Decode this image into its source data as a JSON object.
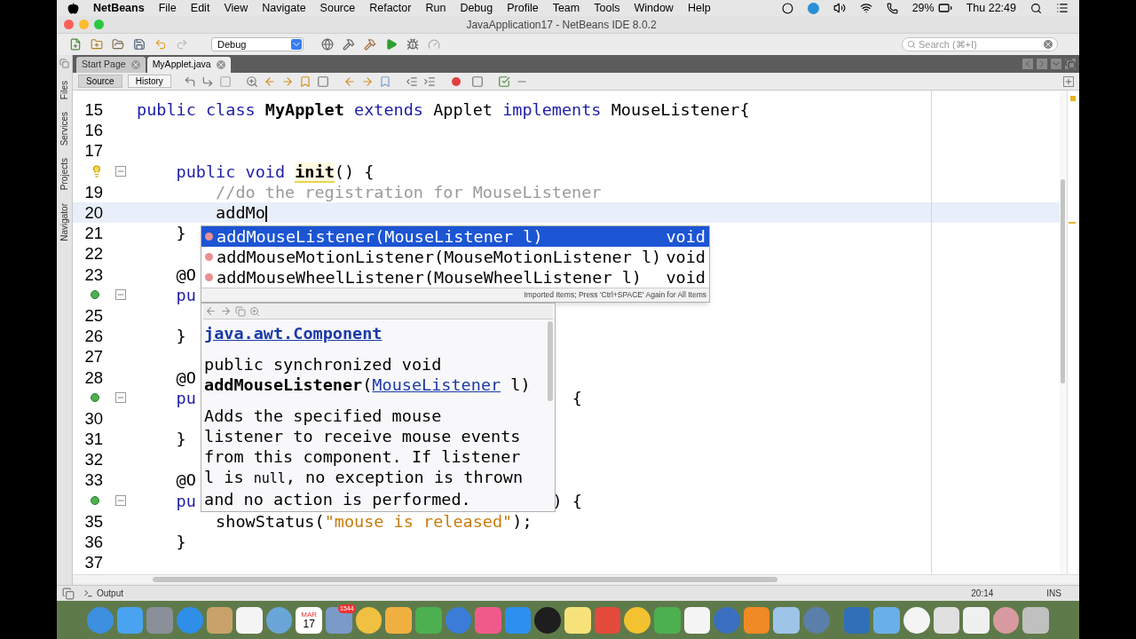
{
  "menu_bar": {
    "app": "NetBeans",
    "items": [
      "File",
      "Edit",
      "View",
      "Navigate",
      "Source",
      "Refactor",
      "Run",
      "Debug",
      "Profile",
      "Team",
      "Tools",
      "Window",
      "Help"
    ],
    "battery": "29%",
    "clock": "Thu 22:49"
  },
  "window": {
    "title": "JavaApplication17 - NetBeans IDE 8.0.2"
  },
  "toolbar": {
    "configuration": "Debug",
    "search": {
      "placeholder": "Search (⌘+I)"
    }
  },
  "side_tabs": [
    "Files",
    "Services",
    "Projects",
    "Navigator"
  ],
  "editor_tabs": [
    {
      "label": "Start Page",
      "selected": false
    },
    {
      "label": "MyApplet.java",
      "selected": true
    }
  ],
  "view_tabs": [
    {
      "label": "Source",
      "selected": true
    },
    {
      "label": "History",
      "selected": false
    }
  ],
  "code_lines": [
    {
      "number": "15",
      "tokens": [
        {
          "kind": "keyword",
          "text": "public class "
        },
        {
          "kind": "bold",
          "text": "MyApplet"
        },
        {
          "kind": "keyword",
          "text": " extends "
        },
        {
          "kind": "plain",
          "text": "Applet "
        },
        {
          "kind": "keyword",
          "text": "implements "
        },
        {
          "kind": "plain",
          "text": "MouseListener{"
        }
      ]
    },
    {
      "number": "16"
    },
    {
      "number": "17"
    },
    {
      "kind": "hint",
      "foldable": true,
      "tokens": [
        {
          "kind": "keyword",
          "text": "    public void "
        },
        {
          "kind": "highlighted",
          "text": "init"
        },
        {
          "kind": "plain",
          "text": "() {"
        }
      ]
    },
    {
      "number": "19",
      "tokens": [
        {
          "kind": "comment",
          "text": "        //do the registration for MouseListener"
        }
      ]
    },
    {
      "number": "20",
      "current": true,
      "cursor": true,
      "tokens": [
        {
          "kind": "plain",
          "text": "        addMo"
        }
      ]
    },
    {
      "number": "21",
      "tokens": [
        {
          "kind": "plain",
          "text": "    }"
        }
      ]
    },
    {
      "number": "22"
    },
    {
      "number": "23",
      "tokens": [
        {
          "kind": "plain",
          "text": "    @O"
        }
      ]
    },
    {
      "kind": "override",
      "foldable": true,
      "tokens": [
        {
          "kind": "keyword",
          "text": "    pu"
        }
      ]
    },
    {
      "number": "25"
    },
    {
      "number": "26",
      "tokens": [
        {
          "kind": "plain",
          "text": "    }"
        }
      ]
    },
    {
      "number": "27"
    },
    {
      "number": "28",
      "tokens": [
        {
          "kind": "plain",
          "text": "    @O"
        }
      ]
    },
    {
      "kind": "override",
      "foldable": true,
      "tokens": [
        {
          "kind": "keyword",
          "text": "    pu"
        }
      ],
      "tail": "{"
    },
    {
      "number": "30"
    },
    {
      "number": "31",
      "tokens": [
        {
          "kind": "plain",
          "text": "    }"
        }
      ]
    },
    {
      "number": "32"
    },
    {
      "number": "33",
      "tokens": [
        {
          "kind": "plain",
          "text": "    @O"
        }
      ]
    },
    {
      "kind": "override",
      "foldable": true,
      "tokens": [
        {
          "kind": "keyword",
          "text": "    pu"
        }
      ],
      "tail": ") {"
    },
    {
      "number": "35",
      "tokens": [
        {
          "kind": "plain",
          "text": "        showStatus("
        },
        {
          "kind": "string",
          "text": "\"mouse is released\""
        },
        {
          "kind": "plain",
          "text": ");"
        }
      ]
    },
    {
      "number": "36",
      "tokens": [
        {
          "kind": "plain",
          "text": "    }"
        }
      ]
    },
    {
      "number": "37"
    }
  ],
  "completion": {
    "items": [
      {
        "name": "addMouseListener(MouseListener l)",
        "type": "void",
        "selected": true
      },
      {
        "name": "addMouseMotionListener(MouseMotionListener l)",
        "type": "void",
        "selected": false
      },
      {
        "name": "addMouseWheelListener(MouseWheelListener l)",
        "type": "void",
        "selected": false
      }
    ],
    "footer": "Imported Items; Press 'Ctrl+SPACE' Again for All Items"
  },
  "documentation": {
    "class_link": "java.awt.Component",
    "signature_prefix": "public synchronized void",
    "method": "addMouseListener",
    "param_open": "(",
    "param_type": "MouseListener",
    "param_close": " l)",
    "description": [
      {
        "kind": "text",
        "text": "Adds the specified mouse listener to receive mouse events from this component. If listener l is "
      },
      {
        "kind": "code",
        "text": "null"
      },
      {
        "kind": "text",
        "text": ", no exception is thrown and no action is performed."
      }
    ]
  },
  "status_bar": {
    "output": "Output",
    "position": "20:14",
    "mode": "INS"
  },
  "dock": {
    "calendar_month": "MAR",
    "calendar_day": "17",
    "badge": "1544"
  }
}
